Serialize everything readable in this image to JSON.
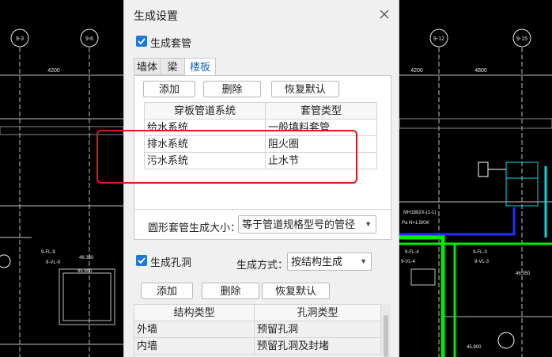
{
  "dialog": {
    "title": "生成设置",
    "sleeve_option_label": "生成套管",
    "sleeve_checked": true,
    "tabs": [
      {
        "label": "墙体",
        "active": false
      },
      {
        "label": "梁",
        "active": false
      },
      {
        "label": "楼板",
        "active": true
      }
    ],
    "sleeve_toolbar": {
      "add": "添加",
      "delete": "删除",
      "restore": "恢复默认"
    },
    "sleeve_table": {
      "headers": [
        "穿板管道系统",
        "套管类型"
      ],
      "rows": [
        [
          "给水系统",
          "一般填料套管"
        ],
        [
          "排水系统",
          "阻火圈"
        ],
        [
          "污水系统",
          "止水节"
        ]
      ]
    },
    "round_size_label": "圆形套管生成大小：",
    "round_size_value": "等于管道规格型号的管径",
    "hole_option_label": "生成孔洞",
    "hole_checked": true,
    "gen_mode_label": "生成方式：",
    "gen_mode_value": "按结构生成",
    "hole_toolbar": {
      "add": "添加",
      "delete": "删除",
      "restore": "恢复默认"
    },
    "hole_table": {
      "headers": [
        "结构类型",
        "孔洞类型"
      ],
      "rows": [
        [
          "外墙",
          "预留孔洞"
        ],
        [
          "内墙",
          "预留孔洞及封堵"
        ]
      ]
    }
  },
  "background": {
    "axis_labels": [
      "9-3",
      "9-6",
      "9-12",
      "9-15"
    ],
    "dimensions": [
      "4200",
      "4200",
      "4800"
    ],
    "room_labels": [
      "9-FL-9",
      "9-VL-9",
      "9-FL-4",
      "9-VL-4",
      "9-FL-3",
      "9-VL-3"
    ],
    "elevations": [
      "46.350",
      "45.900",
      "46.350",
      "45.900"
    ],
    "equipment_text": "MH1882X-(1-1)",
    "equipment_power": "Pa  N=1.5KW"
  },
  "colors": {
    "accent": "#1e78d4",
    "highlight_box": "#e01818",
    "pipe_green": "#00ee00",
    "pipe_blue": "#2030ff",
    "pipe_cyan": "#00d8e0"
  }
}
